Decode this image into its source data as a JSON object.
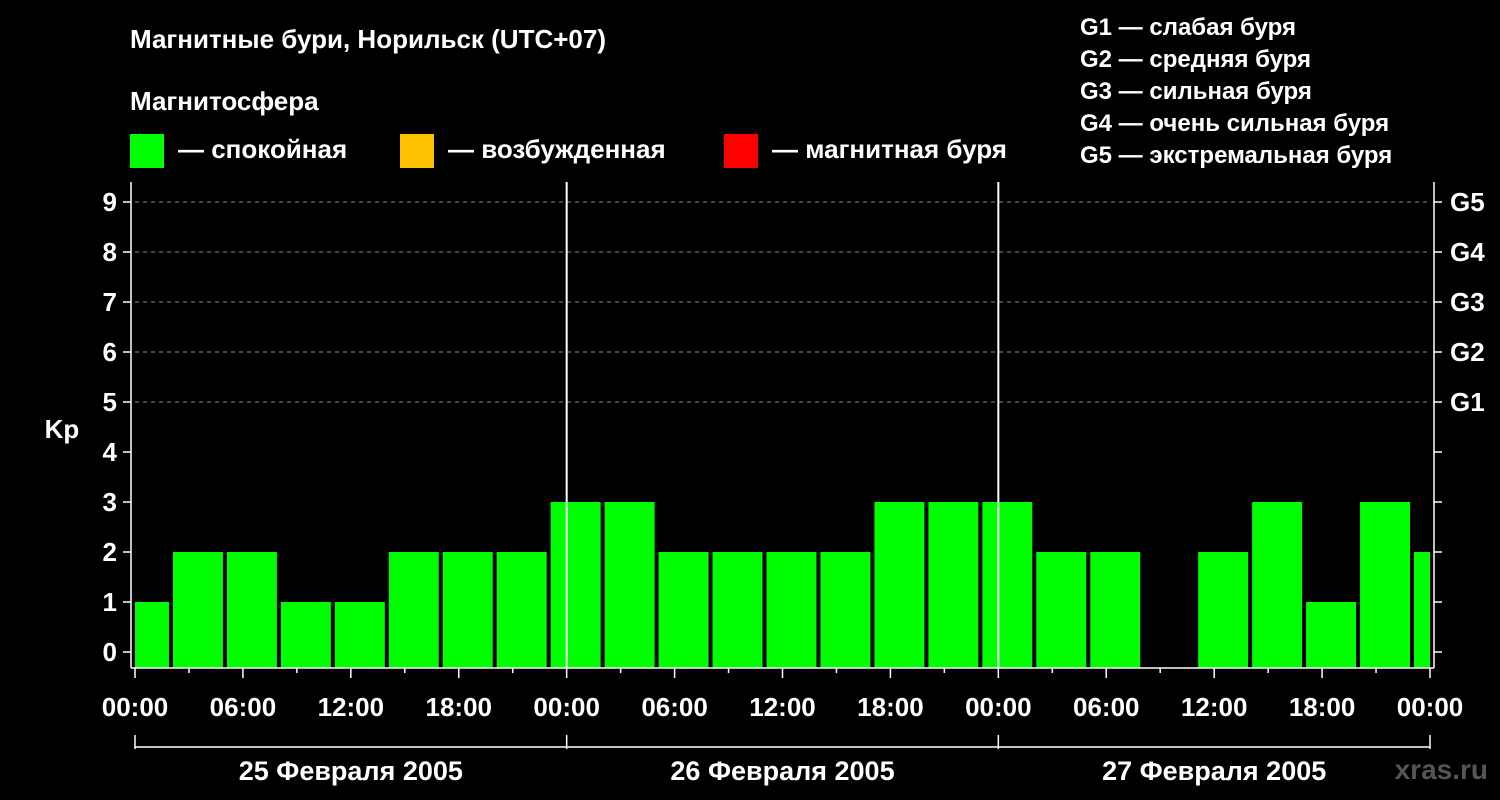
{
  "title": "Магнитные бури, Норильск (UTC+07)",
  "legend": {
    "heading": "Магнитосфера",
    "items": [
      {
        "label": "— спокойная",
        "color": "#00ff00"
      },
      {
        "label": "— возбужденная",
        "color": "#ffc000"
      },
      {
        "label": "— магнитная буря",
        "color": "#ff0000"
      }
    ]
  },
  "g_scale": [
    "G1 — слабая буря",
    "G2 — средняя буря",
    "G3 — сильная буря",
    "G4 — очень сильная буря",
    "G5 — экстремальная буря"
  ],
  "watermark": "xras.ru",
  "chart_data": {
    "type": "bar",
    "ylabel": "Kp",
    "ylim": [
      0,
      9
    ],
    "y_ticks": [
      "0",
      "1",
      "2",
      "3",
      "4",
      "5",
      "6",
      "7",
      "8",
      "9"
    ],
    "right_ticks": [
      {
        "kp": 5,
        "label": "G1"
      },
      {
        "kp": 6,
        "label": "G2"
      },
      {
        "kp": 7,
        "label": "G3"
      },
      {
        "kp": 8,
        "label": "G4"
      },
      {
        "kp": 9,
        "label": "G5"
      }
    ],
    "x_tick_labels": [
      "00:00",
      "06:00",
      "12:00",
      "18:00",
      "00:00",
      "06:00",
      "12:00",
      "18:00",
      "00:00",
      "06:00",
      "12:00",
      "18:00",
      "00:00"
    ],
    "days": [
      "25 Февраля 2005",
      "26 Февраля 2005",
      "27 Февраля 2005"
    ],
    "grid": "horizontal dashed",
    "bar_color": "#00ff00",
    "start_hour": -1,
    "interval_hours": 3,
    "values": [
      1,
      2,
      2,
      1,
      1,
      2,
      2,
      2,
      3,
      3,
      2,
      2,
      2,
      2,
      3,
      3,
      3,
      2,
      2,
      0,
      2,
      3,
      1,
      3,
      2
    ]
  }
}
